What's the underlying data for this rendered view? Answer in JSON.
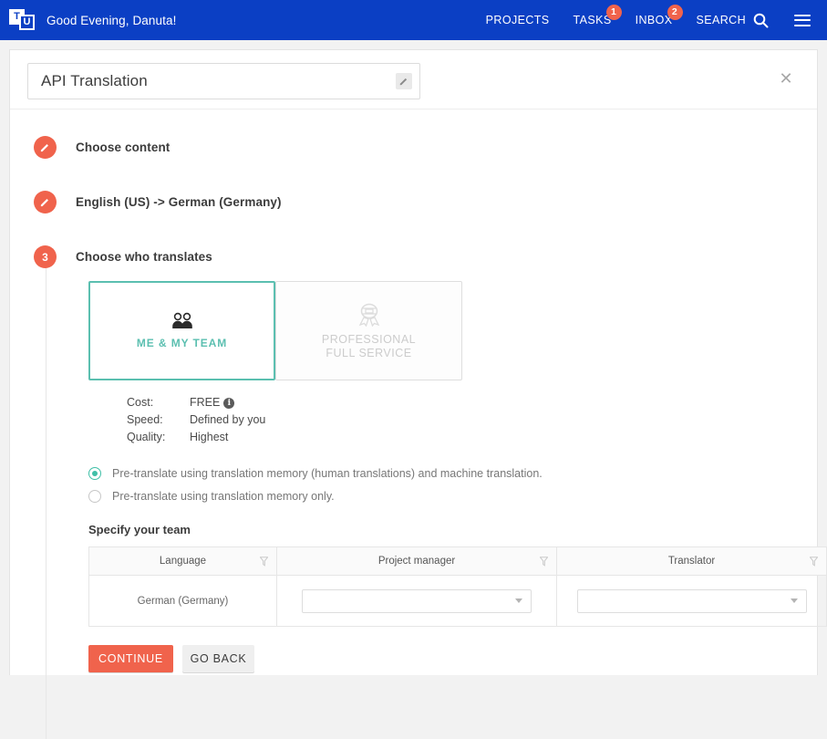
{
  "topbar": {
    "logo_left": "T",
    "logo_right": "U",
    "greeting": "Good Evening, Danuta!",
    "links": [
      {
        "label": "PROJECTS",
        "badge": ""
      },
      {
        "label": "TASKS",
        "badge": "1"
      },
      {
        "label": "INBOX",
        "badge": "2"
      }
    ],
    "search_label": "SEARCH",
    "background_color": "#0b3fc4",
    "badge_color": "#f0634c"
  },
  "card": {
    "title": "API Translation",
    "close_label": "✕"
  },
  "steps": [
    {
      "marker": "✎",
      "label": "Choose content",
      "state": "completed"
    },
    {
      "marker": "✎",
      "label": "English (US) -> German (Germany)",
      "state": "completed"
    },
    {
      "marker": "3",
      "label": "Choose who translates",
      "state": "active"
    }
  ],
  "choices": [
    {
      "label": "ME & MY TEAM",
      "icon": "people-icon",
      "selected": true
    },
    {
      "label_line1": "PROFESSIONAL",
      "label_line2": "FULL SERVICE",
      "icon": "award-badge-icon",
      "selected": false
    }
  ],
  "specs": [
    {
      "key": "Cost:",
      "value": "FREE",
      "info": "i"
    },
    {
      "key": "Speed:",
      "value": "Defined by you",
      "info": ""
    },
    {
      "key": "Quality:",
      "value": "Highest",
      "info": ""
    }
  ],
  "radios": [
    {
      "label": "Pre-translate using translation memory (human translations) and machine translation.",
      "selected": true
    },
    {
      "label": "Pre-translate using translation memory only.",
      "selected": false
    }
  ],
  "team": {
    "heading": "Specify your team",
    "columns": [
      "Language",
      "Project manager",
      "Translator"
    ],
    "rows": [
      {
        "language": "German (Germany)",
        "project_manager": "",
        "translator": ""
      }
    ]
  },
  "buttons": {
    "continue": "CONTINUE",
    "go_back": "GO BACK"
  },
  "colors": {
    "accent_teal": "#5bbfb0",
    "accent_orange": "#f0634c",
    "header_blue": "#0b3fc4"
  }
}
